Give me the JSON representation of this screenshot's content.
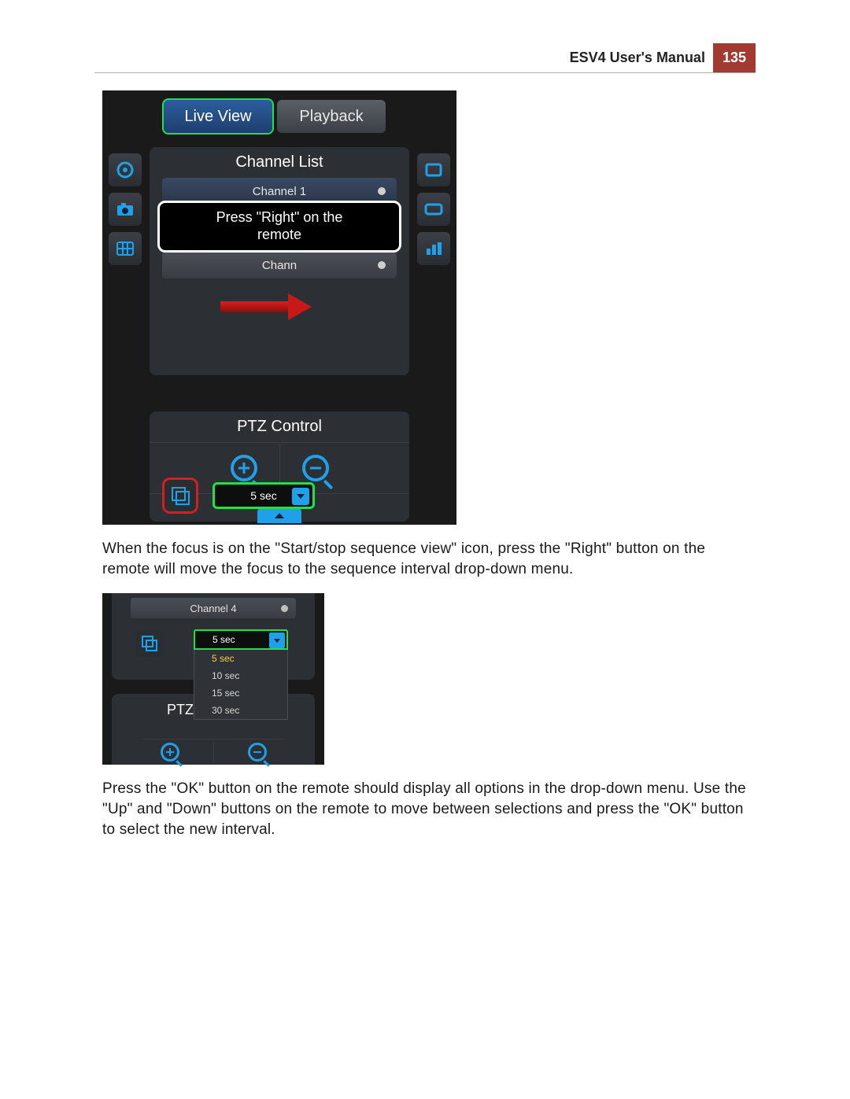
{
  "header": {
    "title": "ESV4 User's Manual",
    "page": "135"
  },
  "shot1": {
    "tabs": {
      "live": "Live View",
      "playback": "Playback"
    },
    "channel_list_title": "Channel List",
    "channel1": "Channel 1",
    "tooltip": "Press \"Right\" on the\nremote",
    "channel_partial": "Chann",
    "seq_value": "5 sec",
    "ptz_title": "PTZ Control"
  },
  "para1": "When the focus is on the \"Start/stop sequence view\" icon, press the \"Right\" button on the remote will move the focus to the sequence interval drop-down menu.",
  "shot2": {
    "channel4": "Channel 4",
    "selected": "5 sec",
    "options": [
      "5 sec",
      "10 sec",
      "15 sec",
      "30 sec"
    ],
    "ptz_label": "PTZ"
  },
  "para2": "Press the \"OK\" button on the remote should display all options in the drop-down menu. Use the \"Up\" and \"Down\" buttons on the remote to move between selections and press the \"OK\" button to select the new interval."
}
